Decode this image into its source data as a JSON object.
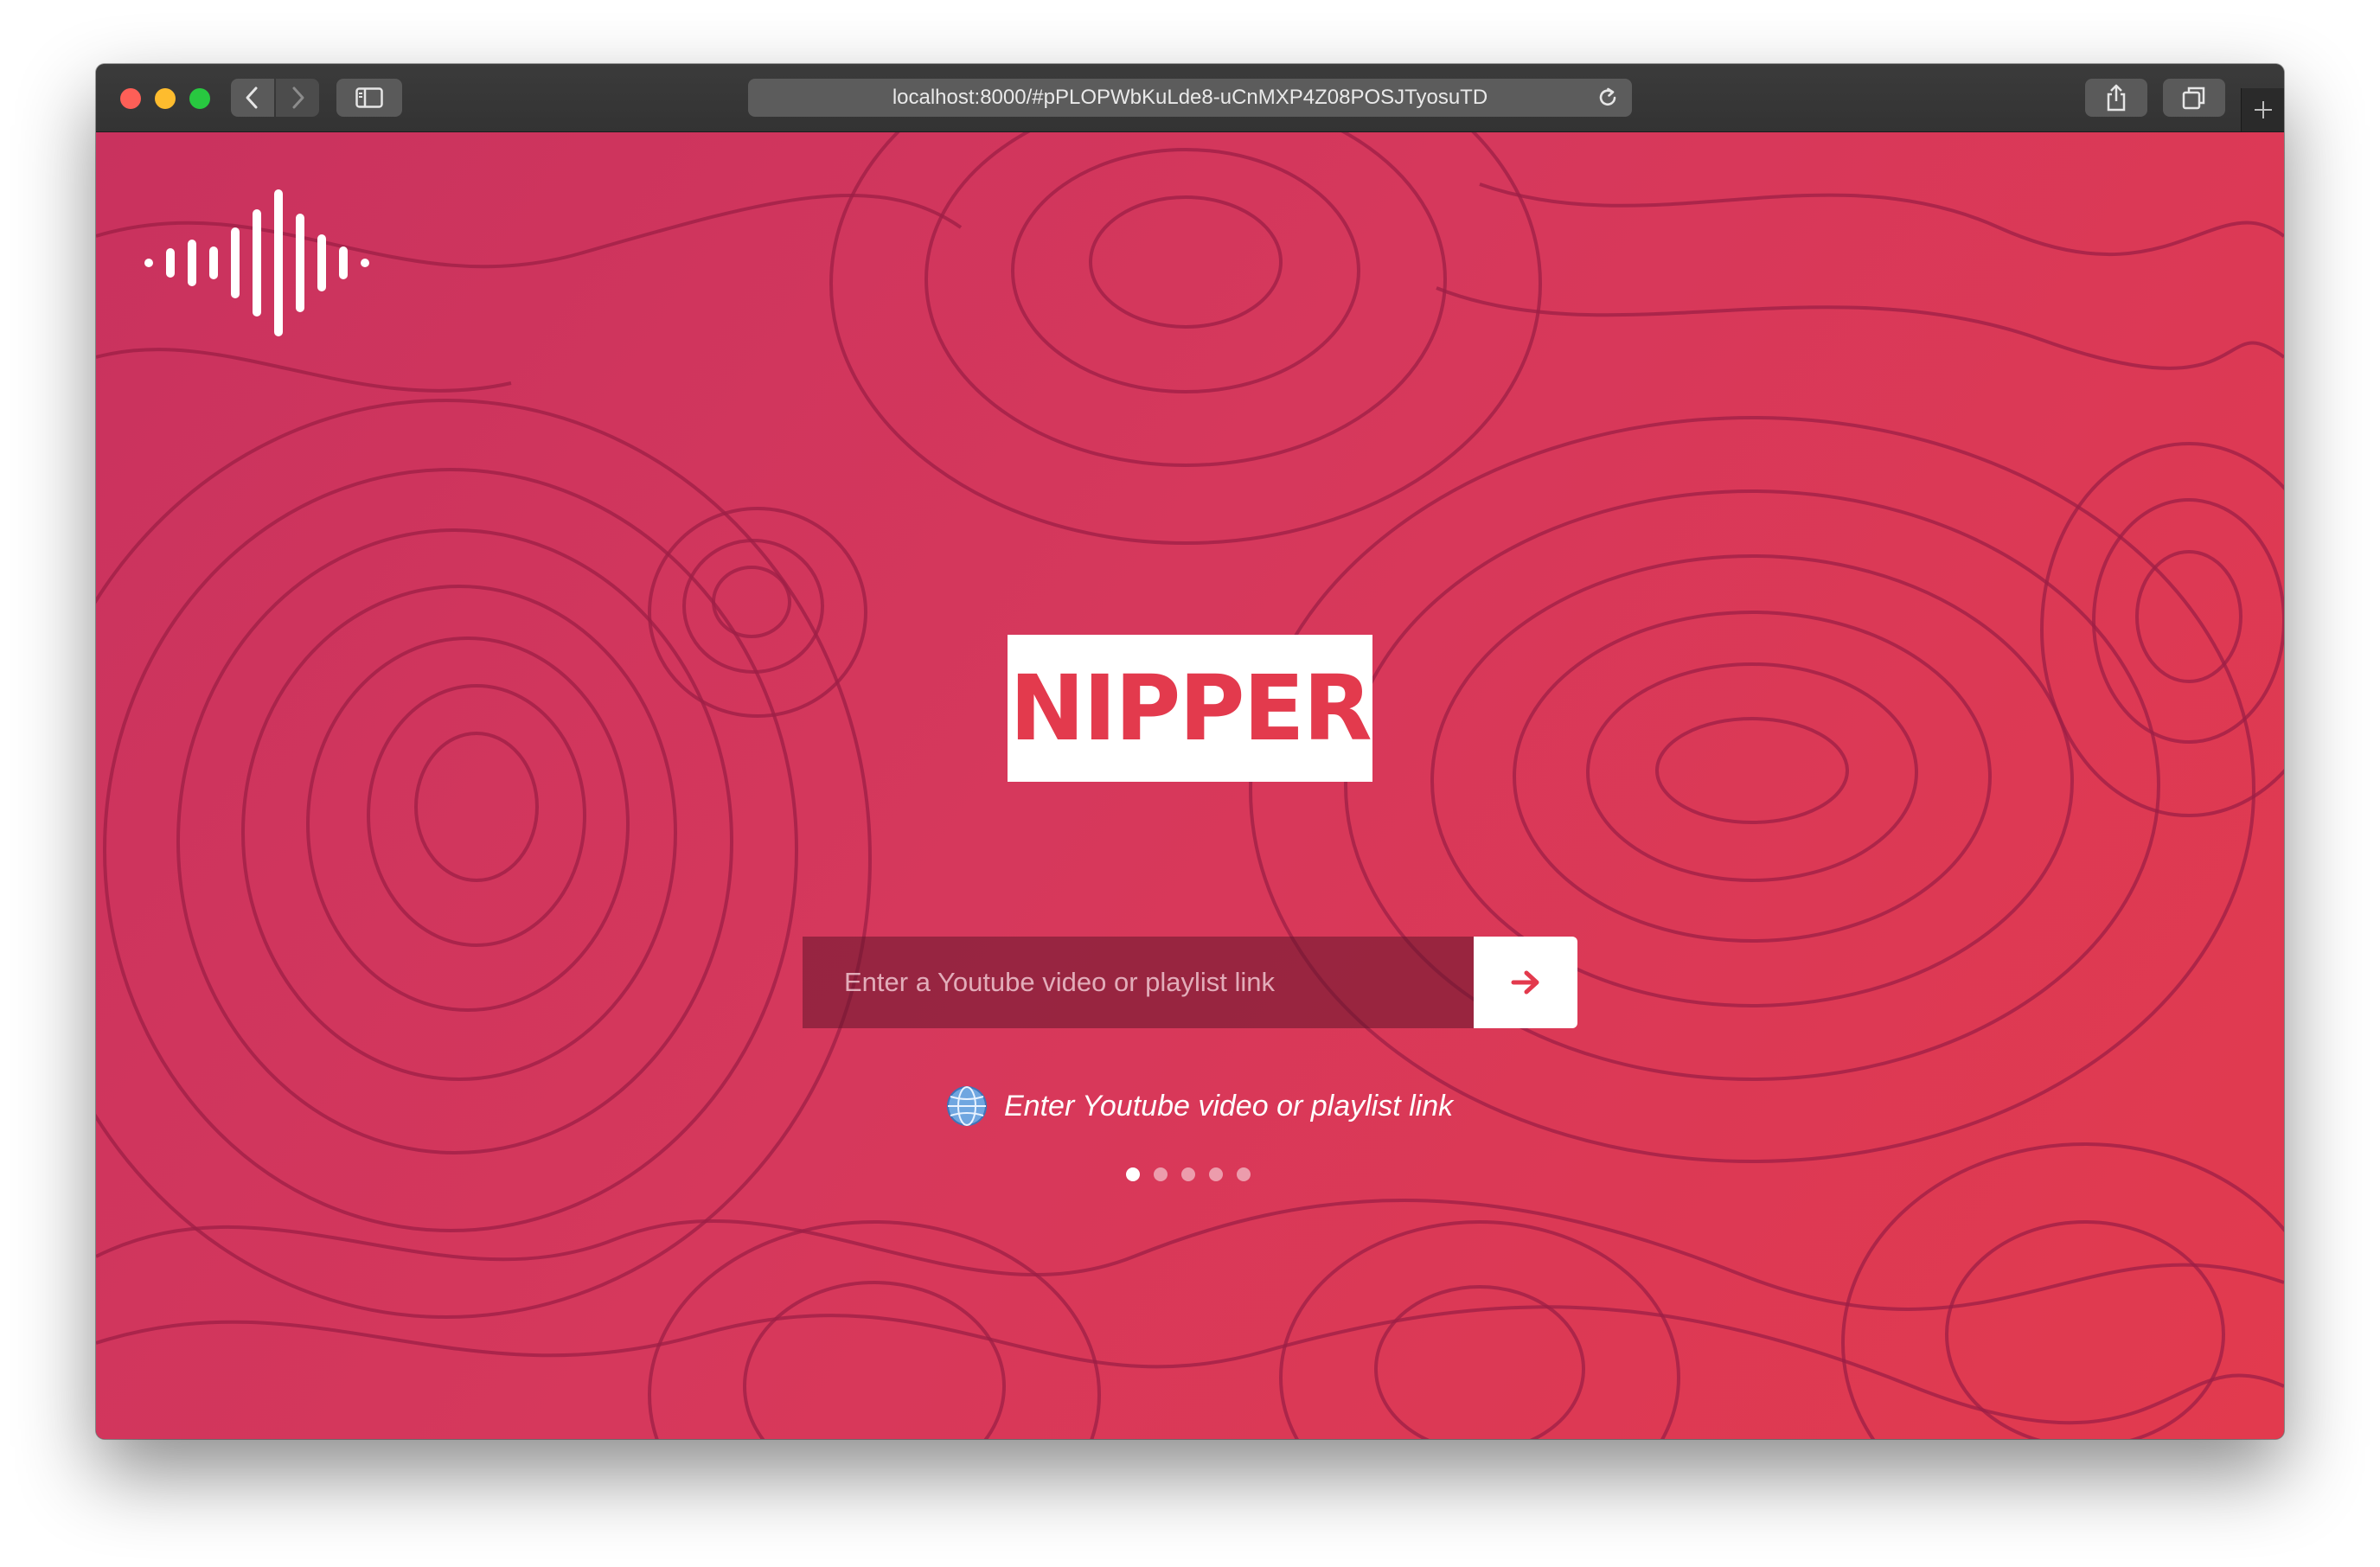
{
  "browser": {
    "url": "localhost:8000/#pPLOPWbKuLde8-uCnMXP4Z08POSJTyosuTD"
  },
  "brand": {
    "name": "NIPPER",
    "color": "#e33a4d",
    "logo_icon": "sound-wave-icon"
  },
  "search": {
    "placeholder": "Enter a Youtube video or playlist link",
    "value": "",
    "submit_icon": "arrow-right-icon"
  },
  "hint": {
    "icon": "globe-icon",
    "text": "Enter Youtube video or playlist link"
  },
  "carousel": {
    "count": 5,
    "active_index": 0
  },
  "footer": {
    "icon": "chevron-up-icon"
  },
  "theme": {
    "background_start": "#c9325e",
    "background_end": "#e23a4e",
    "contour_color": "#9c1f45"
  }
}
